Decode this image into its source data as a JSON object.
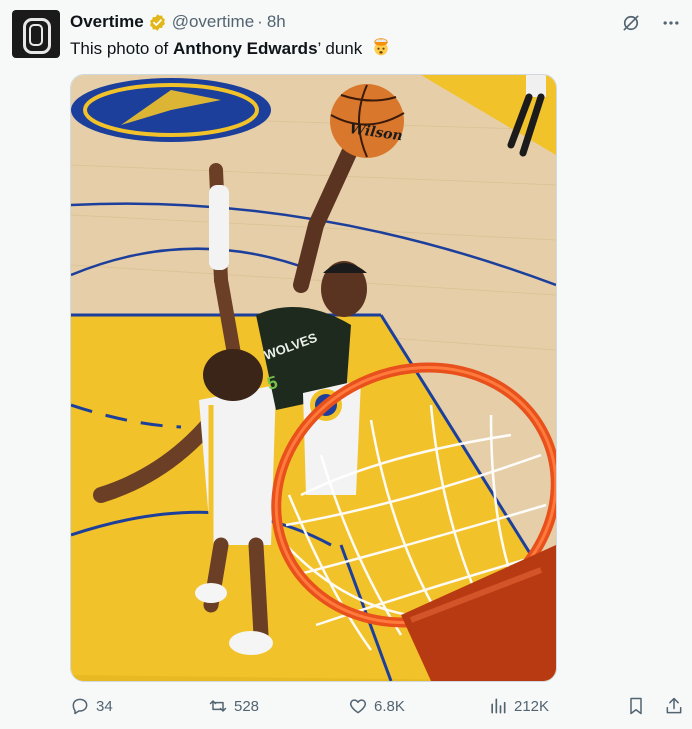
{
  "author": {
    "name": "Overtime",
    "handle": "@overtime",
    "separator": "·",
    "time": "8h"
  },
  "tweet": {
    "text_before": "This photo of ",
    "text_bold": "Anthony Edwards",
    "text_after": "’ dunk",
    "emoji": "exploding-head-emoji"
  },
  "media": {
    "ball_brand": "Wilson",
    "jersey_text": "WOLVES",
    "jersey_number": "5"
  },
  "actions": {
    "replies": "34",
    "reposts": "528",
    "likes": "6.8K",
    "views": "212K"
  },
  "colors": {
    "text": "#0f1419",
    "secondary": "#536471",
    "verified_gold": "#e2b719",
    "court_yellow": "#f2c22a",
    "hardwood": "#e8d2ad",
    "rim_orange": "#e8501c"
  },
  "icons": [
    "verified-badge-icon",
    "grok-icon",
    "more-icon",
    "reply-icon",
    "repost-icon",
    "like-icon",
    "views-icon",
    "bookmark-icon",
    "share-icon"
  ]
}
